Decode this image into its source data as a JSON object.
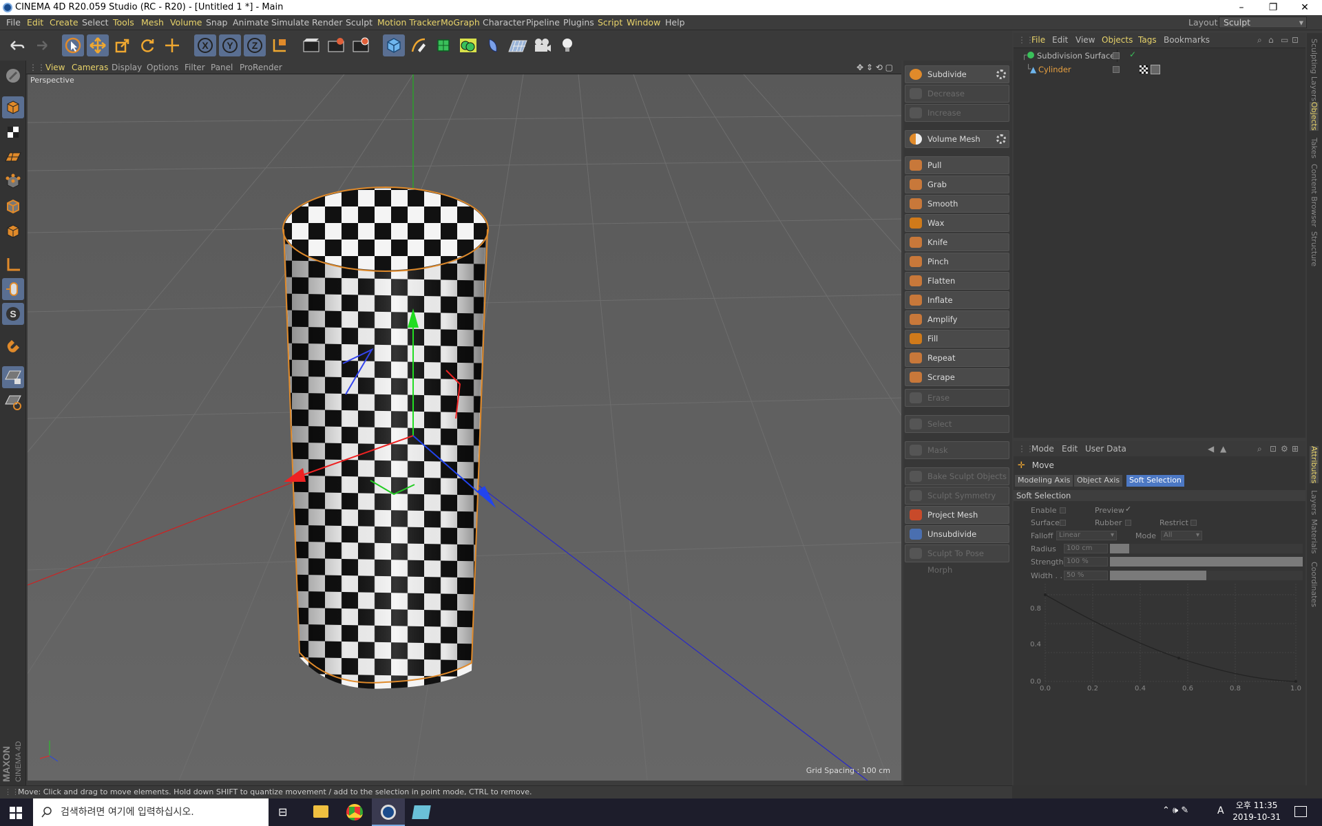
{
  "window": {
    "title": "CINEMA 4D R20.059 Studio (RC - R20) - [Untitled 1 *] - Main",
    "minimize": "–",
    "restore": "❐",
    "close": "✕"
  },
  "menubar": {
    "items": [
      "File",
      "Edit",
      "Create",
      "Select",
      "Tools",
      "Mesh",
      "Volume",
      "Snap",
      "Animate",
      "Simulate",
      "Render",
      "Sculpt",
      "Motion Tracker",
      "MoGraph",
      "Character",
      "Pipeline",
      "Plugins",
      "Script",
      "Window",
      "Help"
    ],
    "layout_label": "Layout:",
    "layout_value": "Sculpt"
  },
  "viewport_menu": {
    "items": [
      "View",
      "Cameras",
      "Display",
      "Options",
      "Filter",
      "Panel",
      "ProRender"
    ]
  },
  "viewport": {
    "label": "Perspective",
    "grid_spacing": "Grid Spacing : 100 cm"
  },
  "sculpt_panel": {
    "subdivide": "Subdivide",
    "decrease": "Decrease",
    "increase": "Increase",
    "volume_mesh": "Volume Mesh",
    "brushes": [
      "Pull",
      "Grab",
      "Smooth",
      "Wax",
      "Knife",
      "Pinch",
      "Flatten",
      "Inflate",
      "Amplify",
      "Fill",
      "Repeat",
      "Scrape"
    ],
    "erase": "Erase",
    "select": "Select",
    "mask": "Mask",
    "bake": "Bake Sculpt Objects",
    "symmetry": "Sculpt Symmetry",
    "project": "Project Mesh",
    "unsubdivide": "Unsubdivide",
    "pose": "Sculpt To Pose Morph"
  },
  "object_manager": {
    "menu": [
      "File",
      "Edit",
      "View",
      "Objects",
      "Tags",
      "Bookmarks"
    ],
    "objects": [
      "Subdivision Surface",
      "Cylinder"
    ]
  },
  "attribute_manager": {
    "menu": [
      "Mode",
      "Edit",
      "User Data"
    ],
    "tool": "Move",
    "tabs": [
      "Modeling Axis",
      "Object Axis",
      "Soft Selection"
    ],
    "section": "Soft Selection",
    "enable": "Enable",
    "preview": "Preview",
    "surface": "Surface",
    "rubber": "Rubber",
    "restrict": "Restrict",
    "falloff": "Falloff",
    "falloff_value": "Linear",
    "mode": "Mode",
    "mode_value": "All",
    "radius": "Radius",
    "radius_value": "100 cm",
    "strength": "Strength",
    "strength_value": "100 %",
    "width": "Width . .",
    "width_value": "50 %",
    "graph_y": [
      "0.8",
      "0.4",
      "0.0"
    ],
    "graph_x": [
      "0.0",
      "0.2",
      "0.4",
      "0.6",
      "0.8",
      "1.0"
    ]
  },
  "right_tabs": [
    "Sculpting Layers",
    "Objects",
    "Takes",
    "Content Browser",
    "Structure",
    "Attributes",
    "Layers",
    "Materials",
    "Coordinates"
  ],
  "status": "Move: Click and drag to move elements. Hold down SHIFT to quantize movement / add to the selection in point mode, CTRL to remove.",
  "taskbar": {
    "search": "검색하려면 여기에 입력하십시오.",
    "time": "오후 11:35",
    "date": "2019-10-31",
    "ime": "A"
  },
  "brand": {
    "maxon": "MAXON",
    "c4d": "CINEMA 4D"
  }
}
